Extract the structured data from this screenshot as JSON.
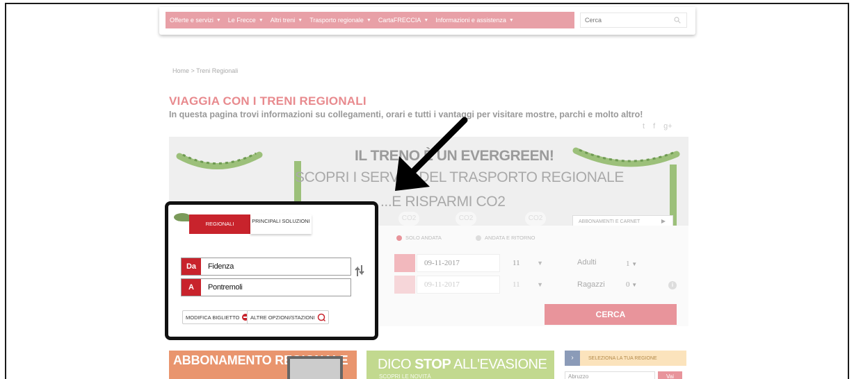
{
  "nav": {
    "items": [
      {
        "label": "Offerte e servizi"
      },
      {
        "label": "Le Frecce"
      },
      {
        "label": "Altri treni"
      },
      {
        "label": "Trasporto regionale"
      },
      {
        "label": "CartaFRECCIA"
      },
      {
        "label": "Informazioni e assistenza"
      }
    ],
    "search_placeholder": "Cerca"
  },
  "breadcrumb": "Home > Treni Regionali",
  "page": {
    "title": "VIAGGIA CON I TRENI REGIONALI",
    "subtitle": "In questa pagina trovi informazioni su collegamenti, orari e tutti i vantaggi per visitare mostre, parchi e molto altro!"
  },
  "banner": {
    "line1": "IL TRENO È UN EVERGREEN!",
    "line2": "SCOPRI I SERVIZI DEL TRASPORTO REGIONALE",
    "line3": "...E RISPARMI CO2",
    "co2_badge": "CO2"
  },
  "booking": {
    "tab_regionali": "REGIONALI",
    "tab_principali": "PRINCIPALI SOLUZIONI",
    "from_label": "Da",
    "from_value": "Fidenza",
    "to_label": "A",
    "to_value": "Pontremoli",
    "modify_ticket": "MODIFICA BIGLIETTO",
    "other_options": "ALTRE OPZIONI/STAZIONI",
    "radio_one_way": "SOLO ANDATA",
    "radio_return": "ANDATA E RITORNO",
    "depart_date": "09-11-2017",
    "depart_hour": "11",
    "return_date": "09-11-2017",
    "return_hour": "11",
    "adults_label": "Adulti",
    "adults_value": "1",
    "kids_label": "Ragazzi",
    "kids_value": "0",
    "search_button": "CERCA",
    "subscriptions_button": "ABBONAMENTI E CARNET",
    "colors": {
      "accent": "#c8232c",
      "soft": "#e8949b"
    }
  },
  "promos": {
    "abbonamento": "ABBONAMENTO REGIONALE",
    "dico_stop_prefix": "DICO ",
    "dico_stop_bold": "STOP",
    "dico_stop_suffix": " ALL'EVASIONE",
    "dico_stop_sub": "SCOPRI LE NOVITÀ",
    "region_title": "SELEZIONA LA TUA REGIONE",
    "region_select": "Abruzzo",
    "region_go": "Vai"
  }
}
